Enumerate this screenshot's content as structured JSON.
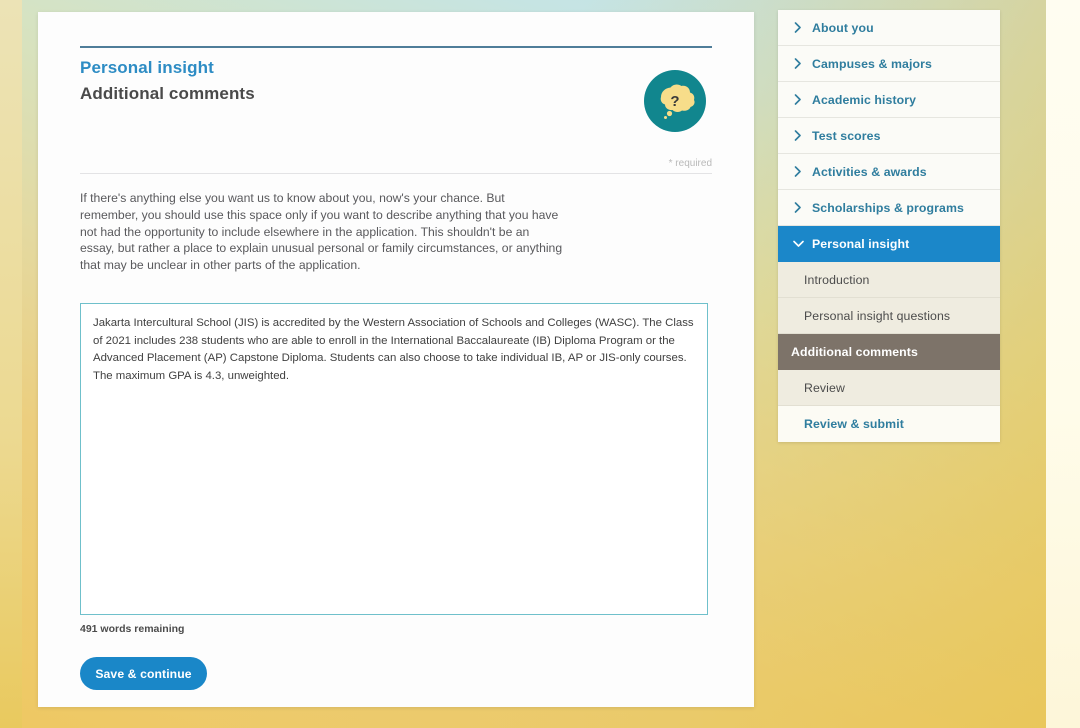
{
  "page": {
    "eyebrow": "Personal insight",
    "title": "Additional comments",
    "required_note": "* required",
    "help_icon": "question-thought-bubble-icon",
    "intro_text": "If there's anything else you want us to know about you, now's your chance. But remember, you should use this space only if you want to describe anything that you have not had the opportunity to include elsewhere in the application. This shouldn't be an essay, but rather a place to explain unusual personal or family circumstances, or anything that may be unclear in other parts of the application."
  },
  "form": {
    "comments_value": "Jakarta Intercultural School (JIS) is accredited by the Western Association of Schools and Colleges (WASC). The Class of 2021 includes 238 students who are able to enroll in the International Baccalaureate (IB) Diploma Program or the Advanced Placement (AP) Capstone Diploma. Students can also choose to take individual IB, AP or JIS-only courses. The maximum GPA is 4.3, unweighted.",
    "comments_placeholder": "",
    "word_count": "491 words remaining",
    "save_label": "Save & continue"
  },
  "sidebar": {
    "items": [
      {
        "label": "About you",
        "type": "top",
        "icon": "chevron-right-icon"
      },
      {
        "label": "Campuses & majors",
        "type": "top",
        "icon": "chevron-right-icon"
      },
      {
        "label": "Academic history",
        "type": "top",
        "icon": "chevron-right-icon"
      },
      {
        "label": "Test scores",
        "type": "top",
        "icon": "chevron-right-icon"
      },
      {
        "label": "Activities & awards",
        "type": "top",
        "icon": "chevron-right-icon"
      },
      {
        "label": "Scholarships & programs",
        "type": "top",
        "icon": "chevron-right-icon"
      },
      {
        "label": "Personal insight",
        "type": "active",
        "icon": "chevron-down-icon"
      },
      {
        "label": "Introduction",
        "type": "sub",
        "icon": ""
      },
      {
        "label": "Personal insight questions",
        "type": "sub",
        "icon": ""
      },
      {
        "label": "Additional comments",
        "type": "sub-current",
        "icon": ""
      },
      {
        "label": "Review",
        "type": "sub",
        "icon": ""
      },
      {
        "label": "Review & submit",
        "type": "final",
        "icon": ""
      }
    ]
  },
  "colors": {
    "accent_blue": "#1b87c9",
    "eyebrow_blue": "#2d8cc4",
    "link_teal": "#2f7d9e",
    "current_sub": "#7d7369",
    "help_circle": "#11868e",
    "help_bubble": "#f7dd8a",
    "textarea_border": "#6fc0cb"
  }
}
